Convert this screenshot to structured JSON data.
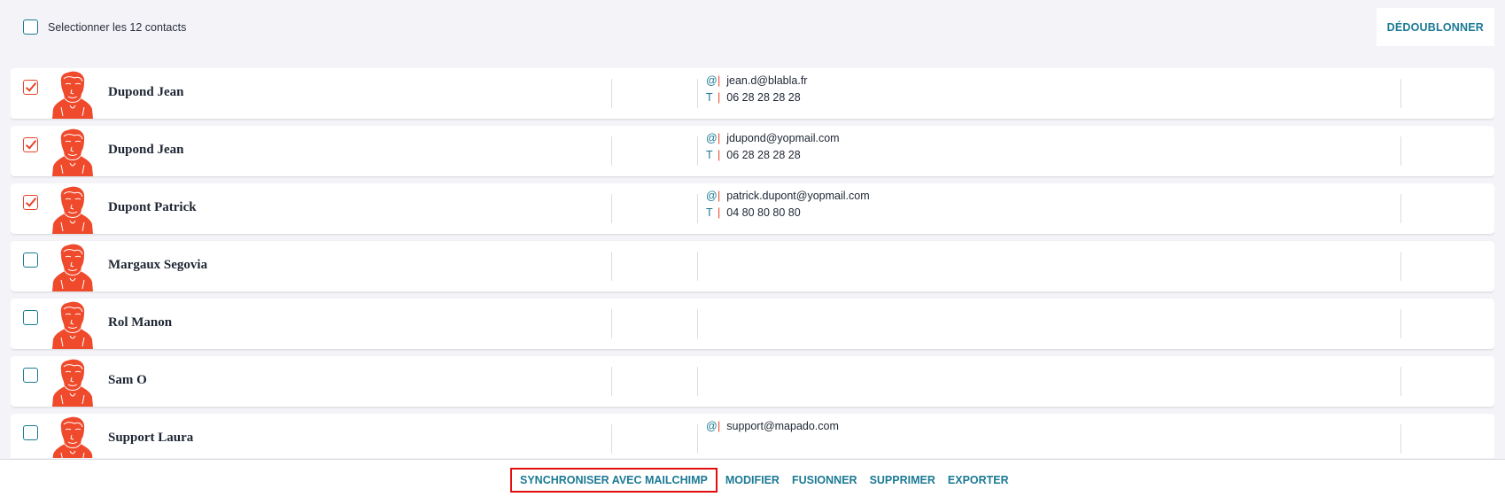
{
  "header": {
    "select_all_label": "Selectionner les 12 contacts",
    "dedupe_label": "DÉDOUBLONNER"
  },
  "contacts": [
    {
      "name": "Dupond Jean",
      "checked": true,
      "email": "jean.d@blabla.fr",
      "phone": "06 28 28 28 28"
    },
    {
      "name": "Dupond Jean",
      "checked": true,
      "email": "jdupond@yopmail.com",
      "phone": "06 28 28 28 28"
    },
    {
      "name": "Dupont Patrick",
      "checked": true,
      "email": "patrick.dupont@yopmail.com",
      "phone": "04 80 80 80 80"
    },
    {
      "name": "Margaux Segovia",
      "checked": false,
      "email": "",
      "phone": ""
    },
    {
      "name": "Rol Manon",
      "checked": false,
      "email": "",
      "phone": ""
    },
    {
      "name": "Sam O",
      "checked": false,
      "email": "",
      "phone": ""
    },
    {
      "name": "Support Laura",
      "checked": false,
      "email": "support@mapado.com",
      "phone": ""
    }
  ],
  "labels": {
    "email_prefix": "@",
    "phone_prefix": "T",
    "separator": "|"
  },
  "actions": {
    "sync_mailchimp": "SYNCHRONISER AVEC MAILCHIMP",
    "modify": "MODIFIER",
    "merge": "FUSIONNER",
    "delete": "SUPPRIMER",
    "export": "EXPORTER"
  },
  "icons": {
    "avatar": "person-avatar-icon",
    "checkbox_checked": "check-icon"
  },
  "colors": {
    "accent": "#1b7a94",
    "brand_red": "#e8442a",
    "highlight_border": "#e20d0d",
    "background": "#f4f3f7"
  }
}
